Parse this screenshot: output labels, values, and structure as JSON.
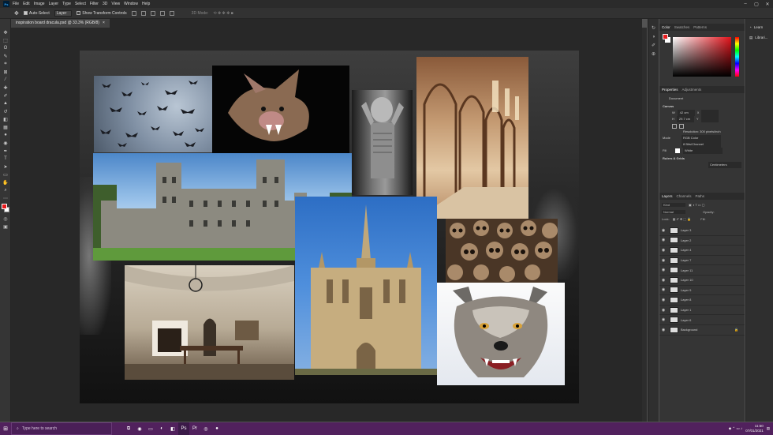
{
  "menubar": {
    "items": [
      "File",
      "Edit",
      "Image",
      "Layer",
      "Type",
      "Select",
      "Filter",
      "3D",
      "View",
      "Window",
      "Help"
    ]
  },
  "options": {
    "auto_select_label": "Auto-Select",
    "layer_dropdown": "Layer",
    "transform_controls_label": "Show Transform Controls",
    "mode_3d": "3D Mode:"
  },
  "document": {
    "tab_title": "inspiration board dracula.psd @ 33.3% (RGB/8)"
  },
  "color_panel": {
    "tabs": [
      "Color",
      "Swatches",
      "Patterns"
    ],
    "fg_color": "#e8191c",
    "bg_color": "#ffffff"
  },
  "properties": {
    "tabs": [
      "Properties",
      "Adjustments"
    ],
    "document_label": "Document",
    "canvas_header": "Canvas",
    "w_label": "W",
    "w_value": "42 cm",
    "h_label": "H",
    "h_value": "29.7 cm",
    "x_label": "X",
    "y_label": "Y",
    "resolution": "Resolution: 300 pixels/inch",
    "mode_label": "Mode",
    "mode_value": "RGB Color",
    "depth_value": "8 Bits/Channel",
    "fill_label": "Fill",
    "fill_value": "White",
    "rulers_header": "Rulers & Grids",
    "units_value": "Centimeters"
  },
  "layers_panel": {
    "tabs": [
      "Layers",
      "Channels",
      "Paths"
    ],
    "kind_filter": "Kind",
    "blend_mode": "Normal",
    "opacity_label": "Opacity:",
    "lock_label": "Lock:",
    "fill_label": "Fill:",
    "layers": [
      "Layer 3",
      "Layer 2",
      "Layer 4",
      "Layer 7",
      "Layer 11",
      "Layer 10",
      "Layer 9",
      "Layer 8",
      "Layer 1",
      "Layer 6",
      "Background"
    ]
  },
  "libraries": {
    "items": [
      "Learn",
      "Librari..."
    ]
  },
  "taskbar": {
    "search_placeholder": "Type here to search",
    "time": "11:50",
    "date": "07/01/2021"
  }
}
